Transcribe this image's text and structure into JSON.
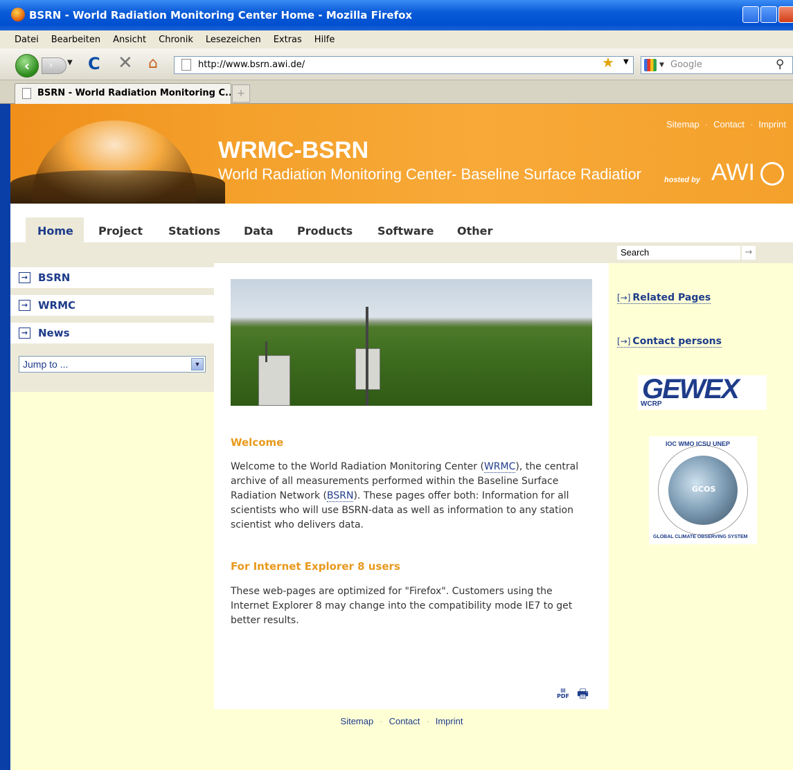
{
  "window": {
    "title": "BSRN - World Radiation Monitoring Center Home - Mozilla Firefox"
  },
  "menu": [
    "Datei",
    "Bearbeiten",
    "Ansicht",
    "Chronik",
    "Lesezeichen",
    "Extras",
    "Hilfe"
  ],
  "toolbar": {
    "url": "http://www.bsrn.awi.de/",
    "search_placeholder": "Google"
  },
  "tab": {
    "label": "BSRN - World Radiation Monitoring C...",
    "new_tab": "+"
  },
  "banner": {
    "title": "WRMC-BSRN",
    "subtitle": "World Radiation Monitoring Center- Baseline Surface Radiatior",
    "hosted_by": "hosted by",
    "awi": "AWI",
    "links": [
      "Sitemap",
      "Contact",
      "Imprint"
    ]
  },
  "nav": [
    "Home",
    "Project",
    "Stations",
    "Data",
    "Products",
    "Software",
    "Other"
  ],
  "search": {
    "placeholder": "Search",
    "go": "→"
  },
  "sidebar": {
    "items": [
      "BSRN",
      "WRMC",
      "News"
    ],
    "jump_to": "Jump to ..."
  },
  "content": {
    "welcome_title": "Welcome",
    "welcome_text_1": "Welcome to the World Radiation Monitoring Center (",
    "welcome_link_1": "WRMC",
    "welcome_text_2": "), the central archive of all measurements performed within the Baseline Surface Radiation Network (",
    "welcome_link_2": "BSRN",
    "welcome_text_3": "). These pages offer both: Information for all scientists who will use BSRN-data as well as information to any station scientist who delivers data.",
    "ie_title": "For Internet Explorer 8 users",
    "ie_text": "These web-pages are optimized for \"Firefox\".  Customers using the Internet Explorer 8 may change into the compatibility mode IE7 to get better results.",
    "pdf_label": "PDF"
  },
  "right": {
    "links": [
      "Related Pages",
      "Contact persons"
    ],
    "arrow": "[→]",
    "gewex": "GEWEX",
    "wcrp": "WCRP",
    "gcos": "GCOS",
    "gcos_ring_top": "IOC  WMO  ICSU  UNEP",
    "gcos_ring_bottom": "GLOBAL CLIMATE OBSERVING SYSTEM"
  },
  "footer": [
    "Sitemap",
    "Contact",
    "Imprint"
  ]
}
